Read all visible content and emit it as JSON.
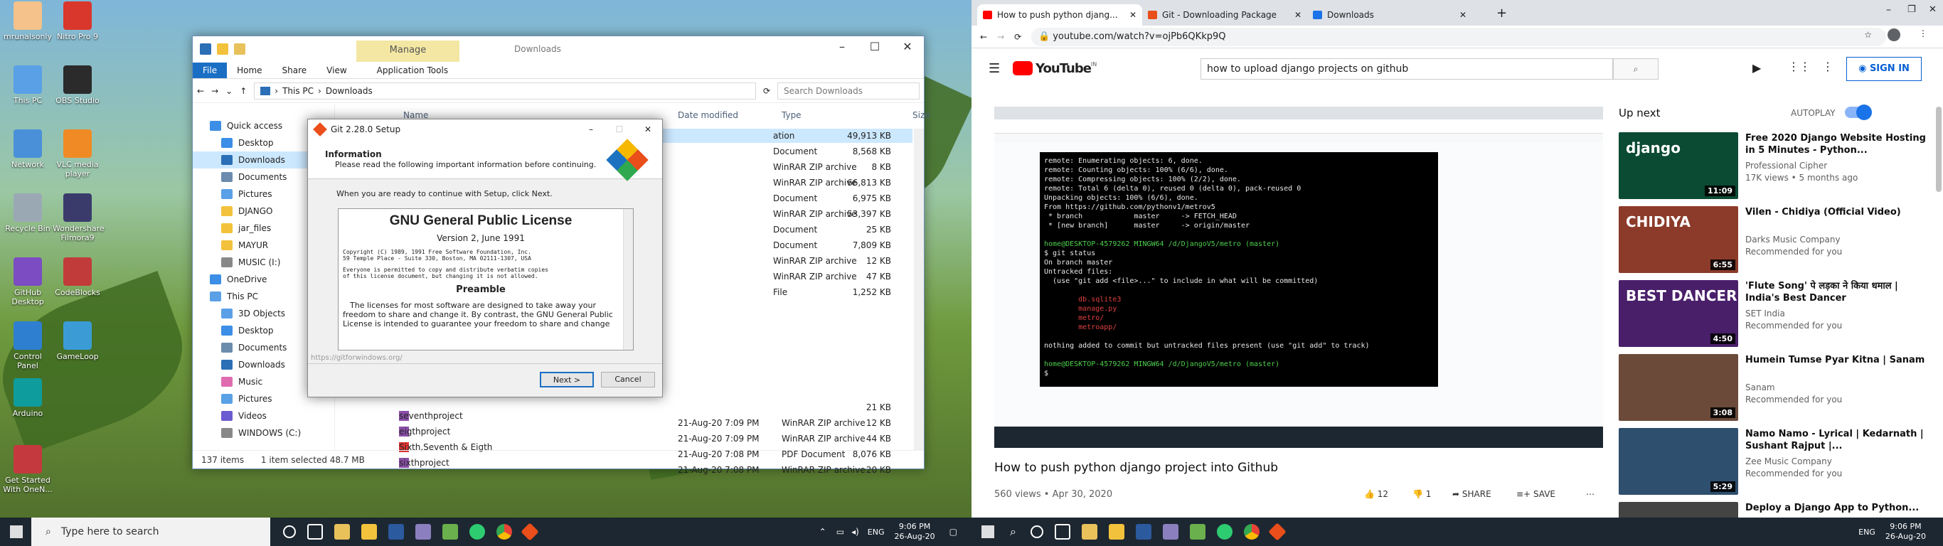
{
  "desktop": {
    "icons": [
      {
        "label": "mrunalsonly"
      },
      {
        "label": "Nitro Pro 9"
      },
      {
        "label": "This PC"
      },
      {
        "label": "OBS Studio"
      },
      {
        "label": "Network"
      },
      {
        "label": "VLC media player"
      },
      {
        "label": "Recycle Bin"
      },
      {
        "label": "Wondershare Filmora9"
      },
      {
        "label": "GitHub Desktop"
      },
      {
        "label": "CodeBlocks"
      },
      {
        "label": "Control Panel"
      },
      {
        "label": "GameLoop"
      },
      {
        "label": "Arduino"
      },
      {
        "label": "Get Started With OneN..."
      }
    ]
  },
  "explorer": {
    "title": "Downloads",
    "manage_tab": "Manage",
    "ribbon": [
      "File",
      "Home",
      "Share",
      "View",
      "Application Tools"
    ],
    "path_root": "This PC",
    "path_leaf": "Downloads",
    "search_placeholder": "Search Downloads",
    "nav": [
      "Quick access",
      "Desktop",
      "Downloads",
      "Documents",
      "Pictures",
      "DJANGO",
      "jar_files",
      "MAYUR",
      "MUSIC (I:)",
      "OneDrive",
      "This PC",
      "3D Objects",
      "Desktop",
      "Documents",
      "Downloads",
      "Music",
      "Pictures",
      "Videos",
      "WINDOWS (C:)"
    ],
    "columns": [
      "Name",
      "Date modified",
      "Type",
      "Size"
    ],
    "rows_top": [
      {
        "type": "ation",
        "size": "49,913 KB"
      },
      {
        "type": "Document",
        "size": "8,568 KB"
      },
      {
        "type": "WinRAR ZIP archive",
        "size": "8 KB"
      },
      {
        "type": "WinRAR ZIP archive",
        "size": "66,813 KB"
      },
      {
        "type": "Document",
        "size": "6,975 KB"
      },
      {
        "type": "WinRAR ZIP archive",
        "size": "53,397 KB"
      },
      {
        "type": "Document",
        "size": "25 KB"
      },
      {
        "type": "Document",
        "size": "7,809 KB"
      },
      {
        "type": "WinRAR ZIP archive",
        "size": "12 KB"
      },
      {
        "type": "WinRAR ZIP archive",
        "size": "47 KB"
      },
      {
        "type": "File",
        "size": "1,252 KB"
      }
    ],
    "rows_bottom": [
      {
        "name": "",
        "date": "",
        "type": "",
        "size": "21 KB"
      },
      {
        "name": "seventhproject",
        "date": "21-Aug-20 7:09 PM",
        "type": "WinRAR ZIP archive",
        "size": "12 KB"
      },
      {
        "name": "eigthproject",
        "date": "21-Aug-20 7:09 PM",
        "type": "WinRAR ZIP archive",
        "size": "44 KB"
      },
      {
        "name": "Sixth,Seventh & Eigth",
        "date": "21-Aug-20 7:08 PM",
        "type": "PDF Document",
        "size": "8,076 KB"
      },
      {
        "name": "sixthproject",
        "date": "21-Aug-20 7:08 PM",
        "type": "WinRAR ZIP archive",
        "size": "20 KB"
      }
    ],
    "status_items": "137 items",
    "status_selected": "1 item selected  48.7 MB"
  },
  "setup": {
    "title": "Git 2.28.0 Setup",
    "heading": "Information",
    "subheading": "Please read the following important information before continuing.",
    "instruction": "When you are ready to continue with Setup, click Next.",
    "license_title": "GNU General Public License",
    "license_version": "Version 2, June 1991",
    "copyright1": "Copyright (C) 1989, 1991 Free Software Foundation, Inc.",
    "copyright2": "59 Temple Place - Suite 330, Boston, MA  02111-1307, USA",
    "everyone1": "Everyone is permitted to copy and distribute verbatim copies",
    "everyone2": "of this license document, but changing it is not allowed.",
    "preamble": "Preamble",
    "para": "The licenses for most software are designed to take away your freedom to share and change it. By contrast, the GNU General Public License is intended to guarantee your freedom to share and change",
    "footer_url": "https://gitforwindows.org/",
    "next_label": "Next >",
    "cancel_label": "Cancel"
  },
  "taskbar_left": {
    "search_placeholder": "Type here to search",
    "lang": "ENG",
    "time": "9:06 PM",
    "date": "26-Aug-20"
  },
  "browser": {
    "tabs": [
      {
        "title": "How to push python djang...",
        "fav": "#ff0000"
      },
      {
        "title": "Git - Downloading Package",
        "fav": "#e94e1b"
      },
      {
        "title": "Downloads",
        "fav": "#1a73e8"
      }
    ],
    "url": "youtube.com/watch?v=ojPb6QKkp9Q"
  },
  "youtube": {
    "logo": "YouTube",
    "logo_sup": "IN",
    "search_text": "how to upload django projects on github",
    "signin": "SIGN IN",
    "video_title": "How to push python django project into Github",
    "views": "560 views • Apr 30, 2020",
    "likes": "12",
    "dislikes": "1",
    "share": "SHARE",
    "save": "SAVE",
    "upnext": "Up next",
    "autoplay": "AUTOPLAY",
    "related": [
      {
        "title": "Free 2020 Django Website Hosting in 5 Minutes - Python...",
        "channel": "Professional Cipher",
        "meta": "17K views • 5 months ago",
        "duration": "11:09",
        "thumb_text": "django",
        "thumb_color": "#0b4b33"
      },
      {
        "title": "Vilen - Chidiya (Official Video)",
        "channel": "Darks Music Company",
        "meta": "Recommended for you",
        "duration": "6:55",
        "thumb_text": "CHIDIYA",
        "thumb_color": "#8c3b2a"
      },
      {
        "title": "'Flute Song' पे लड़का ने किया धमाल | India's Best Dancer",
        "channel": "SET India",
        "meta": "Recommended for you",
        "duration": "4:50",
        "thumb_text": "BEST DANCER",
        "thumb_color": "#4a1f6a"
      },
      {
        "title": "Humein Tumse Pyar Kitna | Sanam",
        "channel": "Sanam",
        "meta": "Recommended for you",
        "duration": "3:08",
        "thumb_text": "",
        "thumb_color": "#6b4a3a"
      },
      {
        "title": "Namo Namo - Lyrical | Kedarnath | Sushant Rajput |...",
        "channel": "Zee Music Company",
        "meta": "Recommended for you",
        "duration": "5:29",
        "thumb_text": "",
        "thumb_color": "#2f4f6f"
      },
      {
        "title": "Deploy a Django App to Python...",
        "channel": "",
        "meta": "",
        "duration": "",
        "thumb_text": "",
        "thumb_color": "#444"
      }
    ]
  },
  "terminal": {
    "lines": [
      {
        "c": "",
        "t": "remote: Enumerating objects: 6, done."
      },
      {
        "c": "",
        "t": "remote: Counting objects: 100% (6/6), done."
      },
      {
        "c": "",
        "t": "remote: Compressing objects: 100% (2/2), done."
      },
      {
        "c": "",
        "t": "remote: Total 6 (delta 0), reused 0 (delta 0), pack-reused 0"
      },
      {
        "c": "",
        "t": "Unpacking objects: 100% (6/6), done."
      },
      {
        "c": "",
        "t": "From https://github.com/pythonv1/metrov5"
      },
      {
        "c": "",
        "t": " * branch            master     -> FETCH_HEAD"
      },
      {
        "c": "",
        "t": " * [new branch]      master     -> origin/master"
      },
      {
        "c": "",
        "t": ""
      },
      {
        "c": "g",
        "t": "home@DESKTOP-4579262 MINGW64 /d/DjangoV5/metro (master)"
      },
      {
        "c": "",
        "t": "$ git status"
      },
      {
        "c": "",
        "t": "On branch master"
      },
      {
        "c": "",
        "t": "Untracked files:"
      },
      {
        "c": "",
        "t": "  (use \"git add <file>...\" to include in what will be committed)"
      },
      {
        "c": "",
        "t": ""
      },
      {
        "c": "r",
        "t": "        db.sqlite3"
      },
      {
        "c": "r",
        "t": "        manage.py"
      },
      {
        "c": "r",
        "t": "        metro/"
      },
      {
        "c": "r",
        "t": "        metroapp/"
      },
      {
        "c": "",
        "t": ""
      },
      {
        "c": "",
        "t": "nothing added to commit but untracked files present (use \"git add\" to track)"
      },
      {
        "c": "",
        "t": ""
      },
      {
        "c": "g",
        "t": "home@DESKTOP-4579262 MINGW64 /d/DjangoV5/metro (master)"
      },
      {
        "c": "",
        "t": "$"
      }
    ]
  },
  "taskbar_right": {
    "lang": "ENG",
    "time": "9:06 PM",
    "date": "26-Aug-20"
  }
}
